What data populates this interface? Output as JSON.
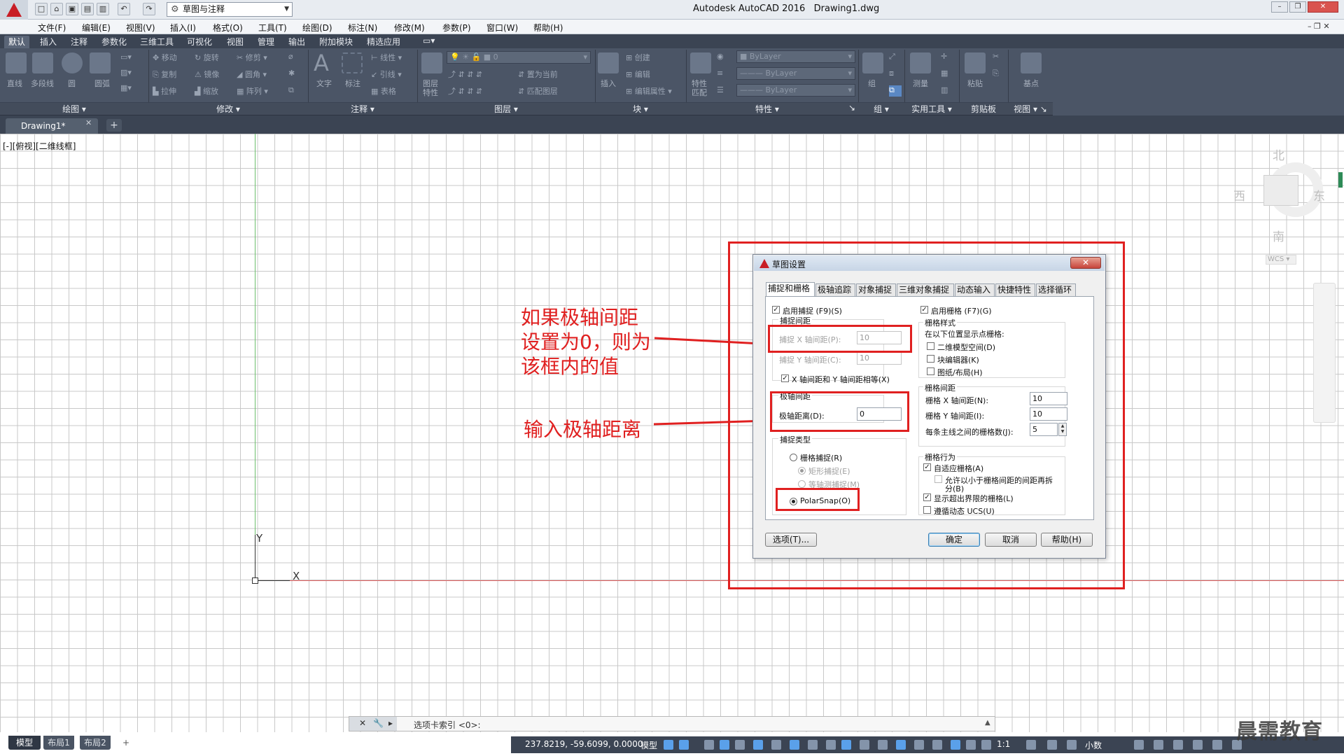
{
  "titlebar": {
    "workspace": "草图与注释",
    "app_title": "Autodesk AutoCAD 2016",
    "file_name": "Drawing1.dwg"
  },
  "menu": [
    "文件(F)",
    "编辑(E)",
    "视图(V)",
    "插入(I)",
    "格式(O)",
    "工具(T)",
    "绘图(D)",
    "标注(N)",
    "修改(M)",
    "参数(P)",
    "窗口(W)",
    "帮助(H)"
  ],
  "ribbon_tabs": [
    "默认",
    "插入",
    "注释",
    "参数化",
    "三维工具",
    "可视化",
    "视图",
    "管理",
    "输出",
    "附加模块",
    "精选应用"
  ],
  "ribbon": {
    "panels": [
      "绘图",
      "修改",
      "注释",
      "图层",
      "块",
      "特性",
      "组",
      "实用工具",
      "剪贴板",
      "视图"
    ],
    "draw_tools": [
      "直线",
      "多段线",
      "圆",
      "圆弧"
    ],
    "modify_tools": [
      "移动",
      "旋转",
      "修剪",
      "复制",
      "镜像",
      "圆角",
      "拉伸",
      "缩放",
      "阵列"
    ],
    "annotation_tools": [
      "文字",
      "标注",
      "线性",
      "引线",
      "表格"
    ],
    "layer_tools": [
      "图层特性",
      "置为当前",
      "匹配图层"
    ],
    "layer_current": "0",
    "block_tools": [
      "插入",
      "创建",
      "编辑",
      "编辑属性"
    ],
    "property_tools": [
      "特性匹配"
    ],
    "property_values": [
      "ByLayer",
      "ByLayer",
      "ByLayer"
    ],
    "group_tools": [
      "组"
    ],
    "utility_tools": [
      "测量"
    ],
    "clipboard_tools": [
      "粘贴"
    ],
    "view_tools": [
      "基点"
    ]
  },
  "doc_tab": "Drawing1*",
  "viewport_label": "[-][俯视][二维线框]",
  "ucs": {
    "y": "Y",
    "x": "X"
  },
  "viewcube": {
    "north": "北",
    "south": "南",
    "east": "东",
    "west": "西",
    "wcs": "WCS"
  },
  "annotations": {
    "note1_line1": "如果极轴间距",
    "note1_line2": "设置为0，则为",
    "note1_line3": "该框内的值",
    "note2": "输入极轴距离"
  },
  "dialog": {
    "title": "草图设置",
    "close": "✕",
    "tabs": [
      "捕捉和栅格",
      "极轴追踪",
      "对象捕捉",
      "三维对象捕捉",
      "动态输入",
      "快捷特性",
      "选择循环"
    ],
    "enable_snap": "启用捕捉 (F9)(S)",
    "enable_grid": "启用栅格 (F7)(G)",
    "snap_spacing_group": "捕捉间距",
    "snap_x_label": "捕捉 X 轴间距(P):",
    "snap_x_value": "10",
    "snap_y_label": "捕捉 Y 轴间距(C):",
    "snap_y_value": "10",
    "equal_xy": "X 轴间距和 Y 轴间距相等(X)",
    "polar_group": "极轴间距",
    "polar_label": "极轴距离(D):",
    "polar_value": "0",
    "snap_type_group": "捕捉类型",
    "grid_snap": "栅格捕捉(R)",
    "rect_snap": "矩形捕捉(E)",
    "iso_snap": "等轴测捕捉(M)",
    "polar_snap": "PolarSnap(O)",
    "grid_style_group": "栅格样式",
    "grid_style_desc": "在以下位置显示点栅格:",
    "model_space": "二维模型空间(D)",
    "block_editor": "块编辑器(K)",
    "sheet_layout": "图纸/布局(H)",
    "grid_spacing_group": "栅格间距",
    "grid_x_label": "栅格 X 轴间距(N):",
    "grid_x_value": "10",
    "grid_y_label": "栅格 Y 轴间距(I):",
    "grid_y_value": "10",
    "major_label": "每条主线之间的栅格数(J):",
    "major_value": "5",
    "grid_behavior_group": "栅格行为",
    "adaptive": "自适应栅格(A)",
    "subdivide_line1": "允许以小于栅格间距的间距再拆",
    "subdivide_line2": "分(B)",
    "beyond_limits": "显示超出界限的栅格(L)",
    "follow_ucs": "遵循动态 UCS(U)",
    "options_btn": "选项(T)...",
    "ok_btn": "确定",
    "cancel_btn": "取消",
    "help_btn": "帮助(H)"
  },
  "command_line": {
    "prompt": "选项卡索引 <0>:"
  },
  "layout_tabs": [
    "模型",
    "布局1",
    "布局2",
    "+"
  ],
  "status": {
    "coords": "237.8219, -59.6099, 0.0000",
    "model": "模型",
    "scale": "1:1",
    "units": "小数"
  },
  "watermark": "晨需教育",
  "colors": {
    "accent_red": "#e02020",
    "ribbon_bg": "#4b5566",
    "autocad_red": "#c81d25"
  }
}
